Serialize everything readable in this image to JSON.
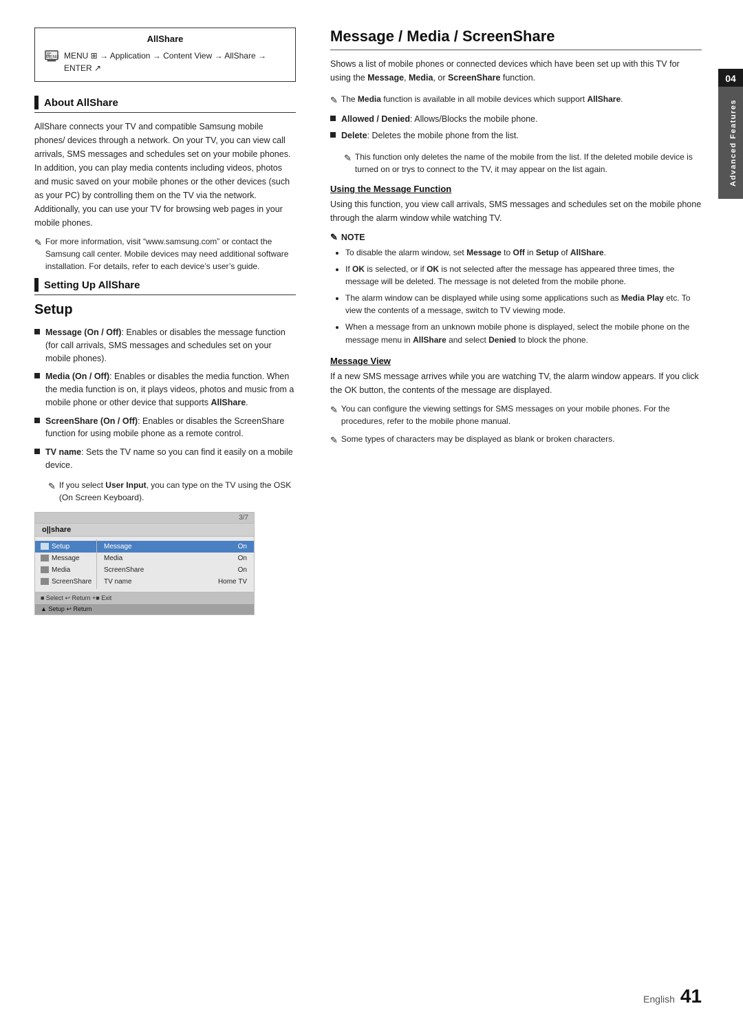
{
  "page": {
    "title": "AllShare / Message Media ScreenShare",
    "chapter_number": "04",
    "chapter_label": "Advanced Features",
    "footer_english": "English",
    "footer_number": "41"
  },
  "allshare_box": {
    "title": "AllShare",
    "menu_path": "MENU ⊞ → Application → Content View → AllShare → ENTER ↗"
  },
  "about_allshare": {
    "heading": "About AllShare",
    "body": "AllShare connects your TV and compatible Samsung mobile phones/ devices through a network. On your TV, you can view call arrivals, SMS messages and schedules set on your mobile phones. In addition, you can play media contents including videos, photos and music saved on your mobile phones or the other devices (such as your PC) by controlling them on the TV via the network. Additionally, you can use your TV for browsing web pages in your mobile phones.",
    "note": "For more information, visit “www.samsung.com” or contact the Samsung call center. Mobile devices may need additional software installation. For details, refer to each device’s user’s guide."
  },
  "setting_up": {
    "heading": "Setting Up AllShare"
  },
  "setup": {
    "heading": "Setup",
    "bullets": [
      {
        "label": "Message (On / Off)",
        "text": ": Enables or disables the message function (for call arrivals, SMS messages and schedules set on your mobile phones)."
      },
      {
        "label": "Media (On / Off)",
        "text": ": Enables or disables the media function. When the media function is on, it plays videos, photos and music from a mobile phone or other device that supports AllShare."
      },
      {
        "label": "ScreenShare (On / Off)",
        "text": ": Enables or disables the ScreenShare function for using mobile phone as a remote control."
      },
      {
        "label": "TV name",
        "text": ": Sets the TV name so you can find it easily on a mobile device."
      }
    ],
    "tv_name_note": "If you select User Input, you can type on the TV using the OSK (On Screen Keyboard).",
    "screenshot": {
      "topbar_text": "3/7",
      "title": "o||share",
      "left_menu": [
        {
          "label": "Setup",
          "selected": true
        },
        {
          "label": "Message",
          "selected": false
        },
        {
          "label": "Media",
          "selected": false
        },
        {
          "label": "ScreenShare",
          "selected": false
        }
      ],
      "right_menu": [
        {
          "key": "Message",
          "value": "On",
          "selected": true
        },
        {
          "key": "Media",
          "value": "On",
          "selected": false
        },
        {
          "key": "ScreenShare",
          "value": "On",
          "selected": false
        },
        {
          "key": "TV name",
          "value": "Home TV",
          "selected": false
        }
      ],
      "bottom1": "■ Select  ↩ Return  +■ Exit",
      "bottom2": "▲ Setup  ↩ Return"
    }
  },
  "message_media": {
    "heading": "Message / Media / ScreenShare",
    "intro": "Shows a list of mobile phones or connected devices which have been set up with this TV for using the Message, Media, or ScreenShare function.",
    "media_note": "The Media function is available in all mobile devices which support AllShare.",
    "bullets": [
      {
        "label": "Allowed / Denied",
        "text": ": Allows/Blocks the mobile phone."
      },
      {
        "label": "Delete",
        "text": ": Deletes the mobile phone from the list."
      }
    ],
    "delete_note": "This function only deletes the name of the mobile from the list. If the deleted mobile device is turned on or trys to connect to the TV, it may appear on the list again.",
    "using_message": {
      "heading": "Using the Message Function",
      "body": "Using this function, you view call arrivals, SMS messages and schedules set on the mobile phone through the alarm window while watching TV."
    },
    "note_box": {
      "label": "NOTE",
      "items": [
        "To disable the alarm window, set Message to Off in Setup of AllShare.",
        "If OK is selected, or if OK is not selected after the message has appeared three times, the message will be deleted. The message is not deleted from the mobile phone.",
        "The alarm window can be displayed while using some applications such as Media Play etc. To view the contents of a message, switch to TV viewing mode.",
        "When a message from an unknown mobile phone is displayed, select the mobile phone on the message menu in AllShare and select Denied to block the phone."
      ]
    },
    "message_view": {
      "heading": "Message View",
      "body": "If a new SMS message arrives while you are watching TV, the alarm window appears. If you click the OK button, the contents of the message are displayed.",
      "note1": "You can configure the viewing settings for SMS messages on your mobile phones. For the procedures, refer to the mobile phone manual.",
      "note2": "Some types of characters may be displayed as blank or broken characters."
    }
  }
}
